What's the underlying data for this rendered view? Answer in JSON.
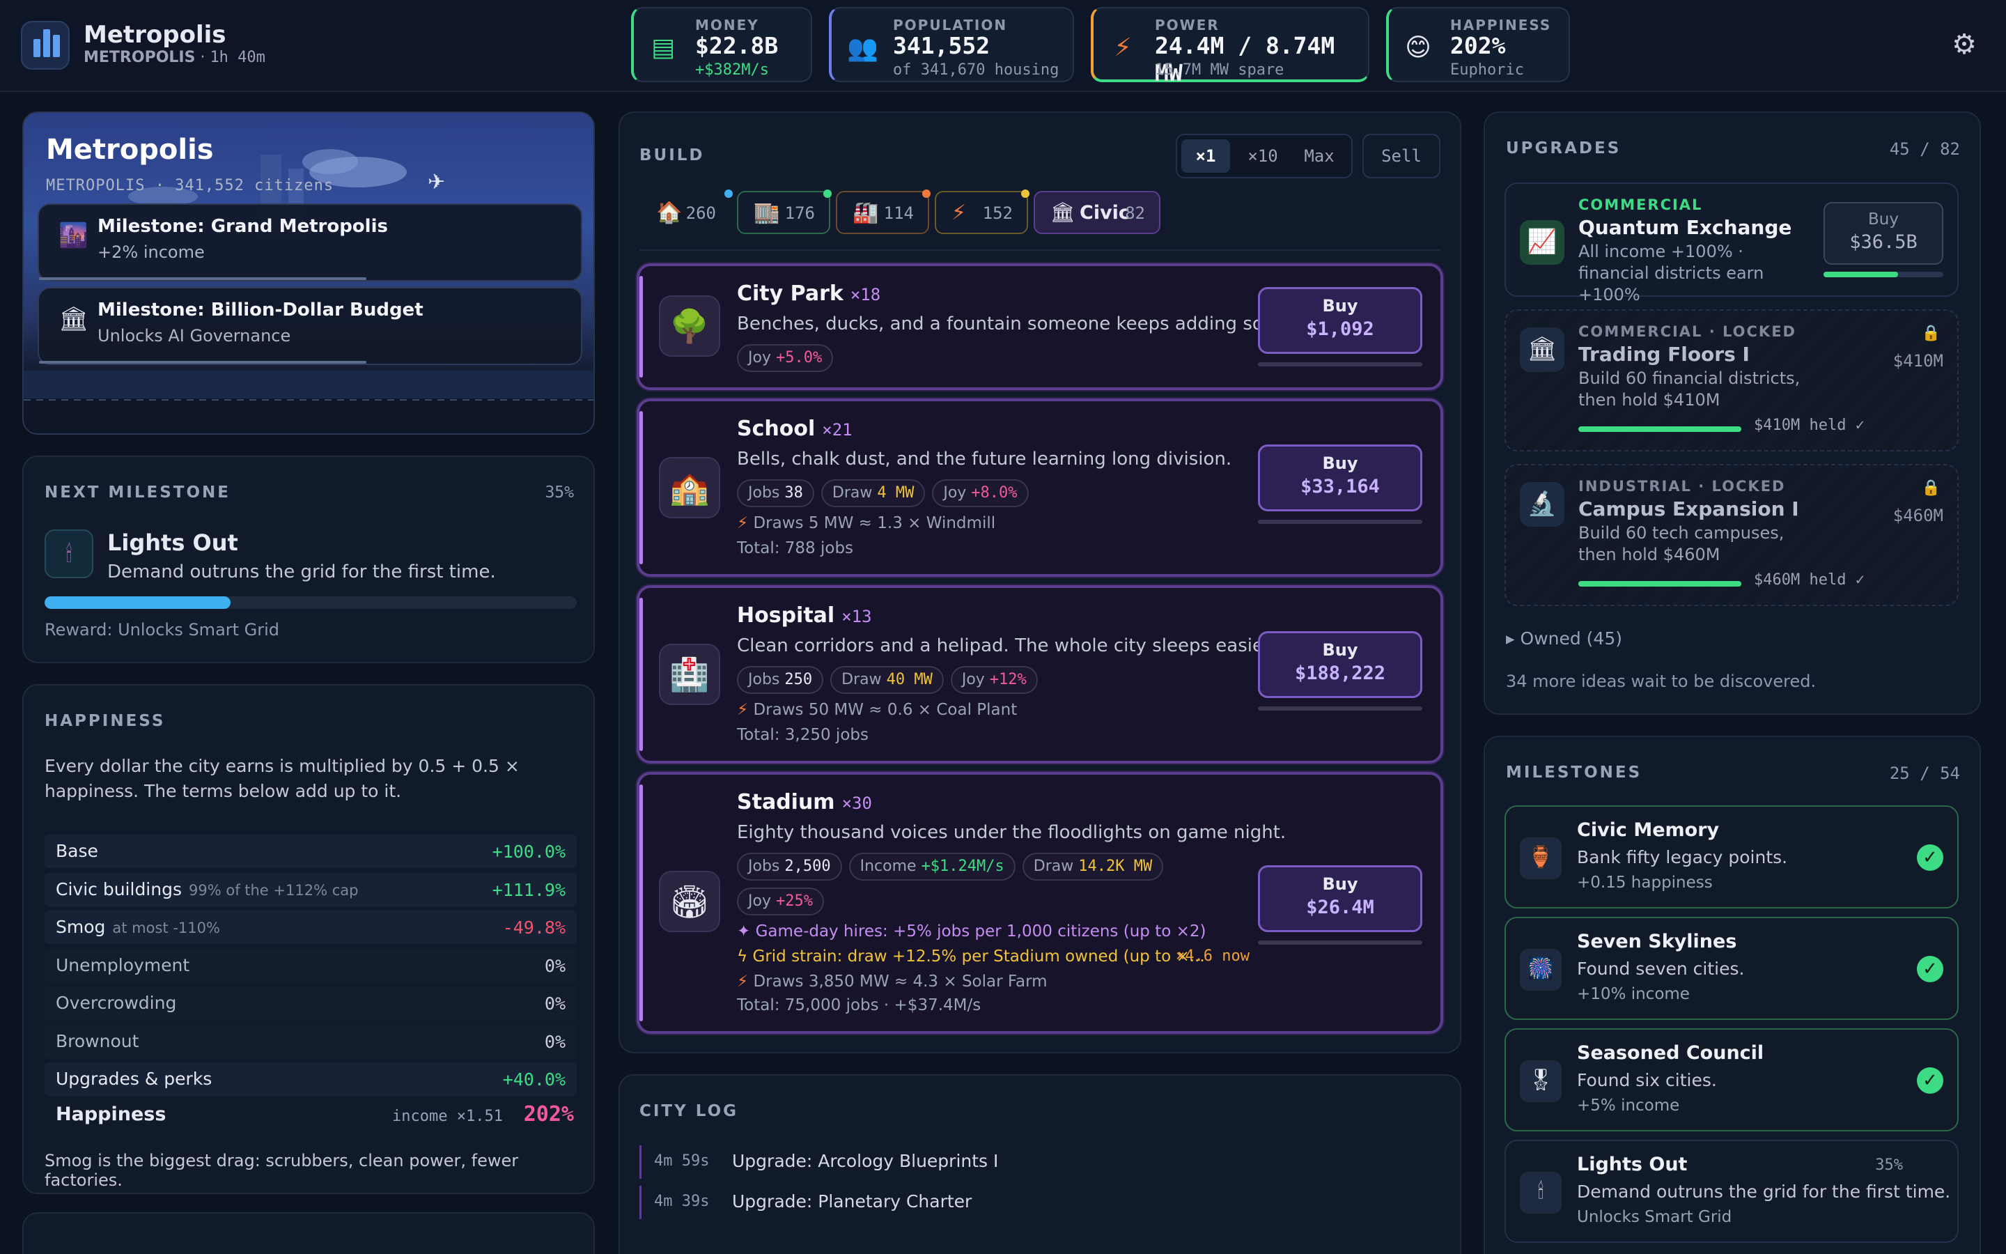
{
  "header": {
    "app_title": "Metropolis",
    "city_name": "METROPOLIS",
    "time": "1h 40m",
    "stats": [
      {
        "label": "MONEY",
        "value": "$22.8B",
        "sub": "+$382M/s",
        "icon": "cash-icon"
      },
      {
        "label": "POPULATION",
        "value": "341,552",
        "sub": "of 341,670 housing",
        "icon": "people-icon"
      },
      {
        "label": "POWER",
        "value": "24.4M / 8.74M MW",
        "sub": "15.7M MW spare",
        "icon": "lightning-icon"
      },
      {
        "label": "HAPPINESS",
        "value": "202%",
        "sub": "Euphoric",
        "icon": "smiley-icon"
      }
    ]
  },
  "hero": {
    "title": "Metropolis",
    "subtitle": "METROPOLIS · 341,552 citizens",
    "toasts": [
      {
        "title": "Milestone: Grand Metropolis",
        "sub": "+2% income"
      },
      {
        "title": "Milestone: Billion-Dollar Budget",
        "sub": "Unlocks AI Governance"
      }
    ]
  },
  "next_milestone": {
    "heading": "NEXT MILESTONE",
    "percent": "35%",
    "progress": 0.35,
    "name": "Lights Out",
    "desc": "Demand outruns the grid for the first time.",
    "reward": "Reward: Unlocks Smart Grid"
  },
  "happiness": {
    "heading": "HAPPINESS",
    "intro": "Every dollar the city earns is multiplied by 0.5 + 0.5 × happiness. The terms below add up to it.",
    "rows": [
      {
        "label": "Base",
        "note": "",
        "value": "+100.0%"
      },
      {
        "label": "Civic buildings",
        "note": "99% of the +112% cap",
        "value": "+111.9%"
      },
      {
        "label": "Smog",
        "note": "at most -110%",
        "value": "-49.8%"
      },
      {
        "label": "Unemployment",
        "note": "",
        "value": "0%"
      },
      {
        "label": "Overcrowding",
        "note": "",
        "value": "0%"
      },
      {
        "label": "Brownout",
        "note": "",
        "value": "0%"
      },
      {
        "label": "Upgrades & perks",
        "note": "",
        "value": "+40.0%"
      }
    ],
    "total_label": "Happiness",
    "total_mult": "income ×1.51",
    "total_value": "202%",
    "footer": "Smog is the biggest drag: scrubbers, clean power, fewer factories."
  },
  "build": {
    "heading": "BUILD",
    "qty": [
      "×1",
      "×10",
      "Max"
    ],
    "sell": "Sell",
    "tabs": [
      {
        "icon": "house-icon",
        "count": "260"
      },
      {
        "icon": "shop-icon",
        "count": "176"
      },
      {
        "icon": "factory-icon",
        "count": "114"
      },
      {
        "icon": "lightning-icon",
        "count": "152"
      },
      {
        "icon": "civic-icon",
        "label": "Civic",
        "count": "82"
      }
    ],
    "cards": [
      {
        "name": "City Park",
        "count": "×18",
        "desc": "Benches, ducks, and a fountain someone keeps adding soap to.",
        "chips": [
          {
            "k": "Joy",
            "v": "+5.0%"
          }
        ],
        "notes": [],
        "buy": "Buy",
        "price": "$1,092"
      },
      {
        "name": "School",
        "count": "×21",
        "desc": "Bells, chalk dust, and the future learning long division.",
        "chips": [
          {
            "k": "Jobs",
            "v": "38"
          },
          {
            "k": "Draw",
            "v": "4 MW"
          },
          {
            "k": "Joy",
            "v": "+8.0%"
          }
        ],
        "notes": [
          "Draws 5 MW ≈ 1.3 × Windmill",
          "Total: 788 jobs"
        ],
        "buy": "Buy",
        "price": "$33,164"
      },
      {
        "name": "Hospital",
        "count": "×13",
        "desc": "Clean corridors and a helipad. The whole city sleeps easier.",
        "chips": [
          {
            "k": "Jobs",
            "v": "250"
          },
          {
            "k": "Draw",
            "v": "40 MW"
          },
          {
            "k": "Joy",
            "v": "+12%"
          }
        ],
        "notes": [
          "Draws 50 MW ≈ 0.6 × Coal Plant",
          "Total: 3,250 jobs"
        ],
        "buy": "Buy",
        "price": "$188,222"
      },
      {
        "name": "Stadium",
        "count": "×30",
        "desc": "Eighty thousand voices under the floodlights on game night.",
        "chips": [
          {
            "k": "Jobs",
            "v": "2,500"
          },
          {
            "k": "Income",
            "v": "+$1.24M/s"
          },
          {
            "k": "Draw",
            "v": "14.2K MW"
          },
          {
            "k": "Joy",
            "v": "+25%"
          }
        ],
        "perk1": "Game-day hires: +5% jobs per 1,000 citizens (up to ×2)",
        "perk2": "Grid strain: draw +12.5% per Stadium owned (up to ×...",
        "perk2_now": "×4.6 now",
        "notes": [
          "Draws 3,850 MW ≈ 4.3 × Solar Farm",
          "Total: 75,000 jobs · +$37.4M/s"
        ],
        "buy": "Buy",
        "price": "$26.4M"
      }
    ]
  },
  "city_log": {
    "heading": "CITY LOG",
    "entries": [
      {
        "time": "4m 59s",
        "text": "Upgrade: Arcology Blueprints I"
      },
      {
        "time": "4m 39s",
        "text": "Upgrade: Planetary Charter"
      }
    ]
  },
  "upgrades": {
    "heading": "UPGRADES",
    "count": "45 / 82",
    "items": [
      {
        "cat": "COMMERCIAL",
        "name": "Quantum Exchange",
        "desc": "All income +100% · financial districts earn +100%",
        "buy": "Buy",
        "price": "$36.5B",
        "progress": 0.62
      },
      {
        "cat": "COMMERCIAL · LOCKED",
        "name": "Trading Floors I",
        "desc": "Build 60 financial districts, then hold $410M",
        "price": "$410M",
        "held": "$410M held ✓"
      },
      {
        "cat": "INDUSTRIAL · LOCKED",
        "name": "Campus Expansion I",
        "desc": "Build 60 tech campuses, then hold $460M",
        "price": "$460M",
        "held": "$460M held ✓"
      }
    ],
    "owned": "Owned (45)",
    "more": "34 more ideas wait to be discovered."
  },
  "milestones": {
    "heading": "MILESTONES",
    "count": "25 / 54",
    "items": [
      {
        "name": "Civic Memory",
        "desc": "Bank fifty legacy points.",
        "reward": "+0.15 happiness"
      },
      {
        "name": "Seven Skylines",
        "desc": "Found seven cities.",
        "reward": "+10% income"
      },
      {
        "name": "Seasoned Council",
        "desc": "Found six cities.",
        "reward": "+5% income"
      },
      {
        "name": "Lights Out",
        "percent": "35%",
        "desc": "Demand outruns the grid for the first time.",
        "reward": "Unlocks Smart Grid"
      }
    ]
  },
  "colors": {
    "accent": "#b67cf0",
    "positive": "#3ddc84",
    "negative": "#f2556b",
    "info": "#3fb0f0"
  }
}
